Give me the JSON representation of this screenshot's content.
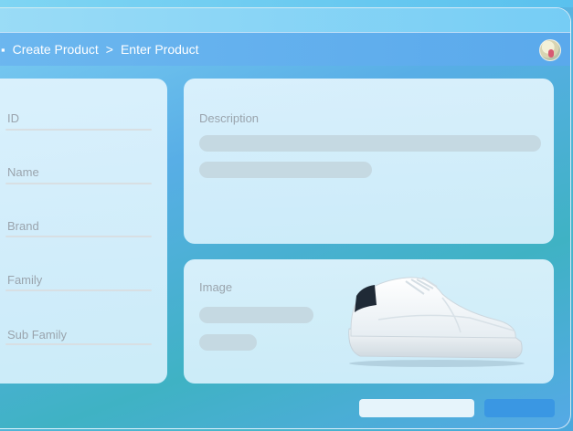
{
  "nav": {
    "crumb_icon": "▪",
    "crumb1": "Create Product",
    "separator": ">",
    "crumb2": "Enter Product"
  },
  "form": {
    "fields": [
      {
        "label": "ID"
      },
      {
        "label": "Name"
      },
      {
        "label": "Brand"
      },
      {
        "label": "Family"
      },
      {
        "label": "Sub Family"
      }
    ]
  },
  "description": {
    "label": "Description"
  },
  "image": {
    "label": "Image"
  },
  "colors": {
    "primary_button": "#3a97e3",
    "card": "#dff3fc",
    "placeholder_bar": "#c5d9e2"
  }
}
